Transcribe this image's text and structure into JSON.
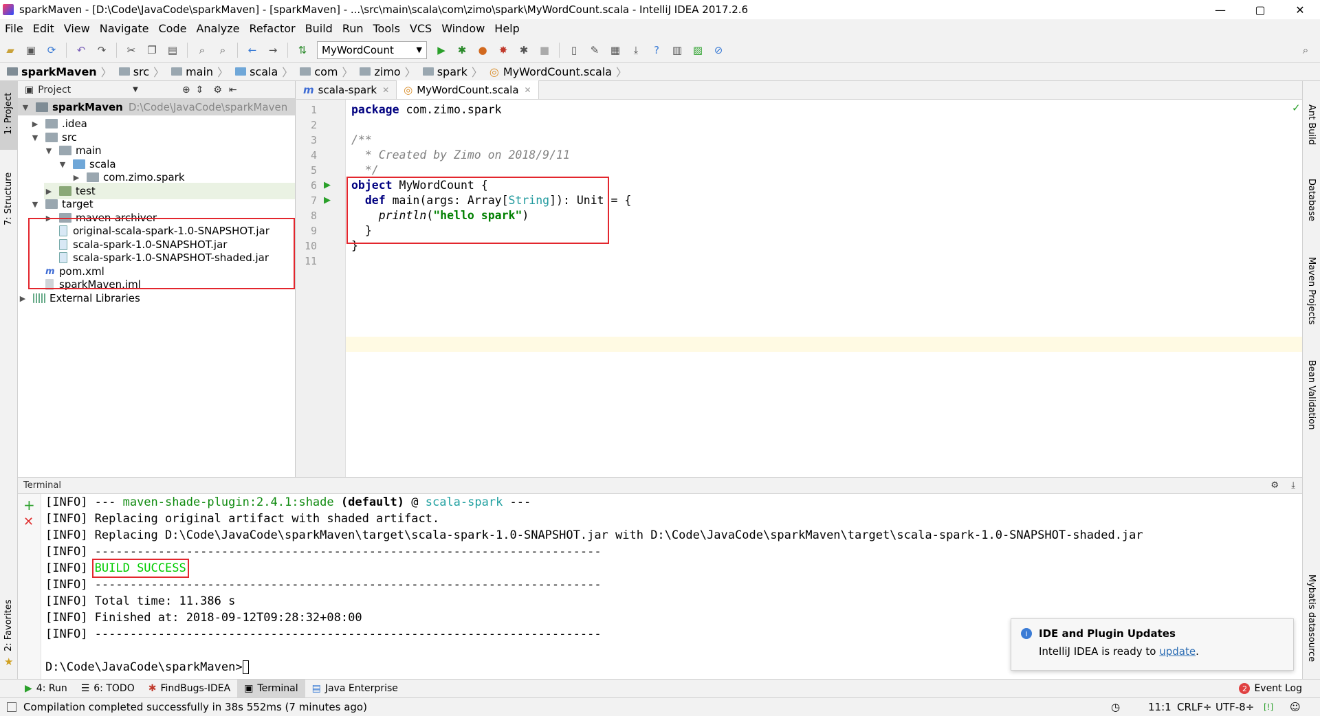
{
  "title": "sparkMaven - [D:\\Code\\JavaCode\\sparkMaven] - [sparkMaven] - ...\\src\\main\\scala\\com\\zimo\\spark\\MyWordCount.scala - IntelliJ IDEA 2017.2.6",
  "menu": [
    "File",
    "Edit",
    "View",
    "Navigate",
    "Code",
    "Analyze",
    "Refactor",
    "Build",
    "Run",
    "Tools",
    "VCS",
    "Window",
    "Help"
  ],
  "run_config": "MyWordCount",
  "breadcrumb": [
    "sparkMaven",
    "src",
    "main",
    "scala",
    "com",
    "zimo",
    "spark",
    "MyWordCount.scala"
  ],
  "left_strip": {
    "project": "1: Project",
    "structure": "7: Structure",
    "favorites": "2: Favorites"
  },
  "right_strip": {
    "ant": "Ant Build",
    "database": "Database",
    "maven": "Maven Projects",
    "bean": "Bean Validation",
    "mybatis": "Mybatis datasource"
  },
  "project": {
    "header": "Project",
    "root": "sparkMaven",
    "root_path": "D:\\Code\\JavaCode\\sparkMaven",
    "items": [
      ".idea",
      "src",
      "main",
      "scala",
      "com.zimo.spark",
      "test",
      "target",
      "maven-archiver",
      "original-scala-spark-1.0-SNAPSHOT.jar",
      "scala-spark-1.0-SNAPSHOT.jar",
      "scala-spark-1.0-SNAPSHOT-shaded.jar",
      "pom.xml",
      "sparkMaven.iml",
      "External Libraries"
    ]
  },
  "tabs": [
    "scala-spark",
    "MyWordCount.scala"
  ],
  "code": {
    "line_numbers": [
      "1",
      "2",
      "3",
      "4",
      "5",
      "6",
      "7",
      "8",
      "9",
      "10",
      "11"
    ],
    "package_kw": "package",
    "package_name": "com.zimo.spark",
    "c1": "/**",
    "c2": "  * Created by Zimo on 2018/9/11",
    "c3": "  */",
    "obj_kw": "object",
    "obj_name": " MyWordCount {",
    "def_kw": "def",
    "def_sig1": " main(args: Array[",
    "def_type": "String",
    "def_sig2": "]): Unit = {",
    "println": "println",
    "println_open": "(",
    "println_str": "\"hello spark\"",
    "println_close": ")",
    "close1": "  }",
    "close2": "}"
  },
  "terminal": {
    "header": "Terminal",
    "l1a": "[INFO] --- ",
    "l1b": "maven-shade-plugin:2.4.1:shade",
    "l1c": " (default)",
    "l1d": " @ ",
    "l1e": "scala-spark",
    "l1f": " ---",
    "l2": "[INFO] Replacing original artifact with shaded artifact.",
    "l3": "[INFO] Replacing D:\\Code\\JavaCode\\sparkMaven\\target\\scala-spark-1.0-SNAPSHOT.jar with D:\\Code\\JavaCode\\sparkMaven\\target\\scala-spark-1.0-SNAPSHOT-shaded.jar",
    "l4": "[INFO] ------------------------------------------------------------------------",
    "l5a": "[INFO] ",
    "l5b": "BUILD SUCCESS",
    "l6": "[INFO] ------------------------------------------------------------------------",
    "l7": "[INFO] Total time: 11.386 s",
    "l8": "[INFO] Finished at: 2018-09-12T09:28:32+08:00",
    "l9": "[INFO] ------------------------------------------------------------------------",
    "prompt": "D:\\Code\\JavaCode\\sparkMaven>"
  },
  "notification": {
    "title": "IDE and Plugin Updates",
    "text": "IntelliJ IDEA is ready to ",
    "link": "update",
    "end": "."
  },
  "bottom_tabs": [
    "4: Run",
    "6: TODO",
    "FindBugs-IDEA",
    "Terminal",
    "Java Enterprise"
  ],
  "event_log": "Event Log",
  "event_count": "2",
  "status": {
    "message": "Compilation completed successfully in 38s 552ms (7 minutes ago)",
    "position": "11:1",
    "line_sep": "CRLF÷",
    "encoding": "UTF-8÷"
  },
  "colors": {
    "accent": "#2b6cb3",
    "redbox": "#e3262d",
    "success": "#00cc00"
  }
}
